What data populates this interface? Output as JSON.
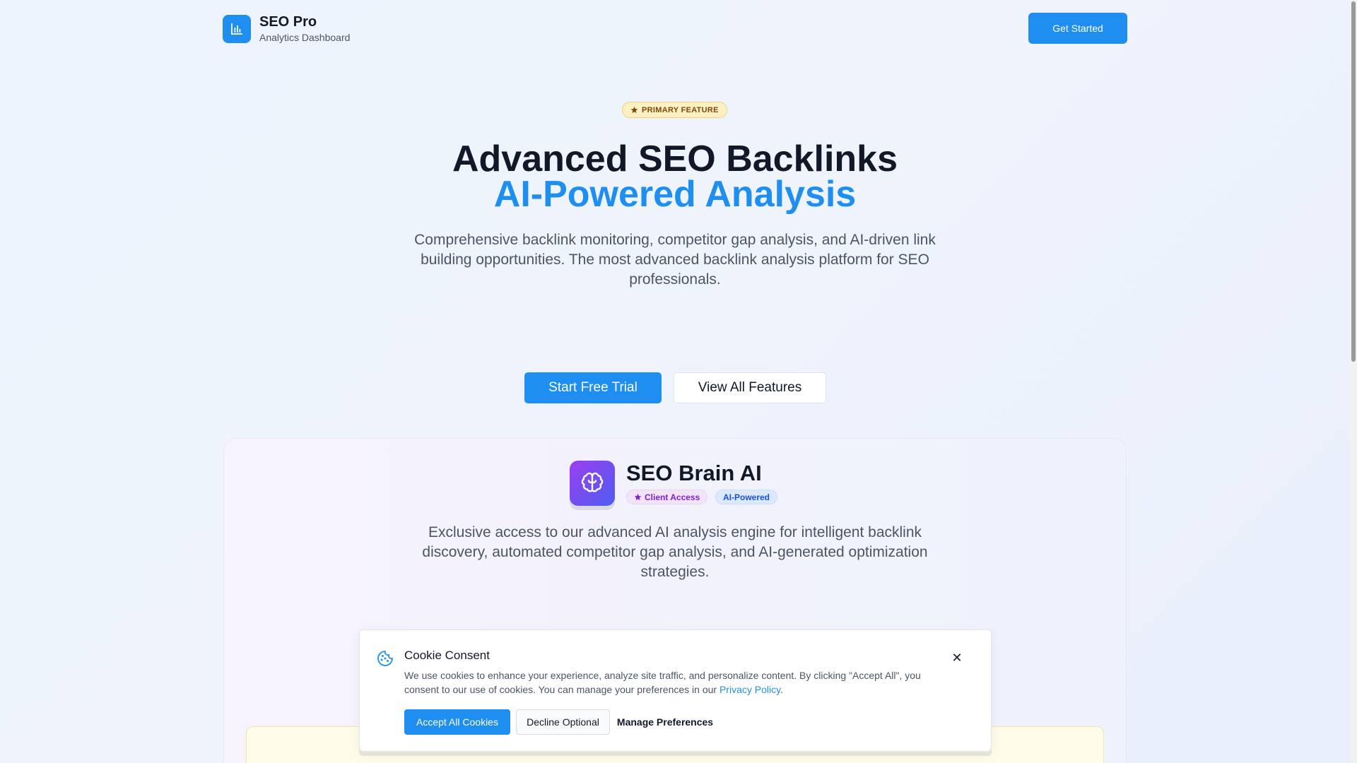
{
  "header": {
    "logo_icon": "bar-chart-icon",
    "brand_title": "SEO Pro",
    "brand_subtitle": "Analytics Dashboard",
    "cta_label": "Get Started"
  },
  "hero": {
    "badge_icon": "star-icon",
    "badge_label": "PRIMARY FEATURE",
    "title_line1": "Advanced SEO Backlinks",
    "title_line2": "AI-Powered Analysis",
    "description": "Comprehensive backlink monitoring, competitor gap analysis, and AI-driven link building opportunities. The most advanced backlink analysis platform for SEO professionals.",
    "primary_button": "Start Free Trial",
    "secondary_button": "View All Features"
  },
  "feature_card": {
    "icon": "brain-icon",
    "title": "SEO Brain AI",
    "tags": [
      {
        "icon": "star-icon",
        "label": "Client Access"
      },
      {
        "label": "AI-Powered"
      }
    ],
    "description": "Exclusive access to our advanced AI analysis engine for intelligent backlink discovery, automated competitor gap analysis, and AI-generated optimization strategies."
  },
  "cookie_banner": {
    "icon": "cookie-icon",
    "title": "Cookie Consent",
    "text_before_link": "We use cookies to enhance your experience, analyze site traffic, and personalize content. By clicking \"Accept All\", you consent to our use of cookies. You can manage your preferences in our ",
    "link_text": "Privacy Policy",
    "text_after_link": ".",
    "close_icon": "close-icon",
    "accept_label": "Accept All Cookies",
    "decline_label": "Decline Optional",
    "manage_label": "Manage Preferences"
  },
  "colors": {
    "accent": "#1e8ff0",
    "brain_gradient_start": "#9b3ff0",
    "brain_gradient_end": "#4f5df0",
    "badge_bg": "#fdf0c2"
  }
}
